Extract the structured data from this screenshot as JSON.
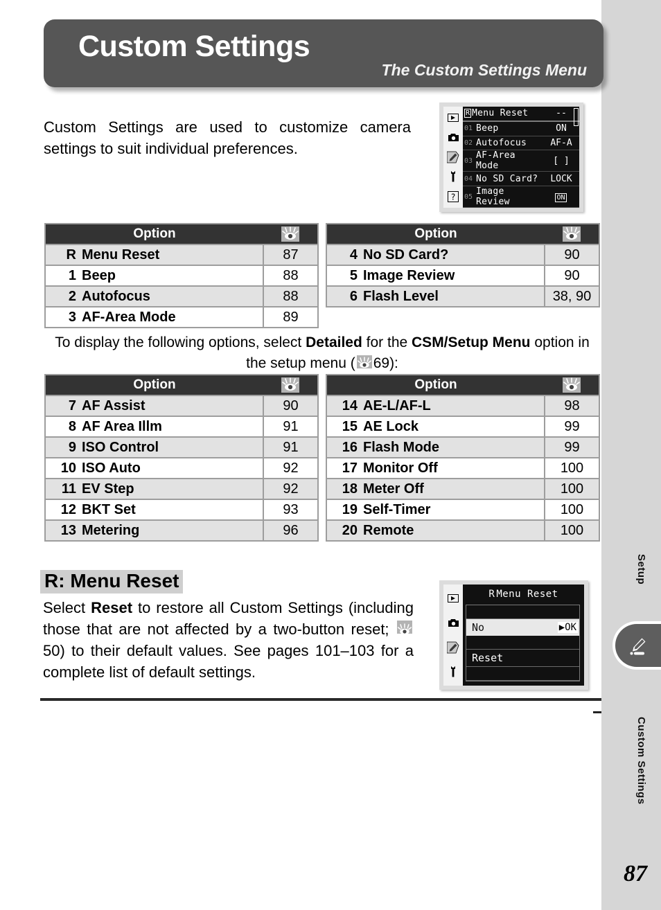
{
  "banner": {
    "title": "Custom Settings",
    "subtitle": "The Custom Settings Menu"
  },
  "intro": "Custom Settings are used to customize camera settings to suit individual preferences.",
  "lcd_menu": {
    "sidebar_icons": [
      "playback-icon",
      "camera-icon",
      "pencil-icon",
      "wrench-icon",
      "question-icon"
    ],
    "rows": [
      {
        "num": "",
        "badge": "R",
        "label": "Menu Reset",
        "value": "--"
      },
      {
        "num": "01",
        "badge": "",
        "label": "Beep",
        "value": "ON"
      },
      {
        "num": "02",
        "badge": "",
        "label": "Autofocus",
        "value": "AF-A"
      },
      {
        "num": "03",
        "badge": "",
        "label": "AF-Area Mode",
        "value": "[ ]"
      },
      {
        "num": "04",
        "badge": "",
        "label": "No SD Card?",
        "value": "LOCK"
      },
      {
        "num": "05",
        "badge": "",
        "label": "Image Review",
        "value": "ON"
      }
    ]
  },
  "lcd_reset": {
    "sidebar_icons": [
      "playback-icon",
      "camera-icon",
      "pencil-icon",
      "wrench-icon"
    ],
    "title_badge": "R",
    "title": "Menu Reset",
    "selected_option": "No",
    "ok_label": "OK",
    "other_option": "Reset"
  },
  "tables": [
    {
      "id": "table-1",
      "header_option": "Option",
      "header_page_icon": "page-reference-icon",
      "rows": [
        {
          "num": "R",
          "label": "Menu Reset",
          "page": "87"
        },
        {
          "num": "1",
          "label": "Beep",
          "page": "88"
        },
        {
          "num": "2",
          "label": "Autofocus",
          "page": "88"
        },
        {
          "num": "3",
          "label": "AF-Area Mode",
          "page": "89"
        }
      ]
    },
    {
      "id": "table-2",
      "header_option": "Option",
      "header_page_icon": "page-reference-icon",
      "rows": [
        {
          "num": "4",
          "label": "No SD Card?",
          "page": "90"
        },
        {
          "num": "5",
          "label": "Image Review",
          "page": "90"
        },
        {
          "num": "6",
          "label": "Flash Level",
          "page": "38, 90"
        }
      ]
    },
    {
      "id": "table-3",
      "header_option": "Option",
      "header_page_icon": "page-reference-icon",
      "rows": [
        {
          "num": "7",
          "label": "AF Assist",
          "page": "90"
        },
        {
          "num": "8",
          "label": "AF Area Illm",
          "page": "91"
        },
        {
          "num": "9",
          "label": "ISO Control",
          "page": "91"
        },
        {
          "num": "10",
          "label": "ISO Auto",
          "page": "92"
        },
        {
          "num": "11",
          "label": "EV Step",
          "page": "92"
        },
        {
          "num": "12",
          "label": "BKT Set",
          "page": "93"
        },
        {
          "num": "13",
          "label": "Metering",
          "page": "96"
        }
      ]
    },
    {
      "id": "table-4",
      "header_option": "Option",
      "header_page_icon": "page-reference-icon",
      "rows": [
        {
          "num": "14",
          "label": "AE-L/AF-L",
          "page": "98"
        },
        {
          "num": "15",
          "label": "AE Lock",
          "page": "99"
        },
        {
          "num": "16",
          "label": "Flash Mode",
          "page": "99"
        },
        {
          "num": "17",
          "label": "Monitor Off",
          "page": "100"
        },
        {
          "num": "18",
          "label": "Meter Off",
          "page": "100"
        },
        {
          "num": "19",
          "label": "Self-Timer",
          "page": "100"
        },
        {
          "num": "20",
          "label": "Remote",
          "page": "100"
        }
      ]
    }
  ],
  "note": {
    "part1": "To display the following options, select ",
    "bold1": "Detailed",
    "part2": " for the ",
    "bold2": "CSM/Setup Menu",
    "part3": " option in the setup menu (",
    "page_ref": "69",
    "part4": "):"
  },
  "section": {
    "heading": "R: Menu Reset",
    "body_part1": "Select ",
    "body_bold": "Reset",
    "body_part2": " to restore all Custom Settings (including those that are not affected by a two-button reset; ",
    "body_page_ref": "50",
    "body_part3": ") to their default values.  See pages 101–103 for a complete list of default settings."
  },
  "sidebar": {
    "label_setup": "Setup",
    "label_custom": "Custom Settings",
    "tab_icon": "pencil-icon"
  },
  "page_number": "87",
  "colors": {
    "banner_bg": "#565656",
    "table_header_bg": "#333333",
    "row_alt_bg": "#e2e2e2",
    "strip_bg": "#d6d6d6",
    "icon_gray": "#b3b3b3"
  }
}
